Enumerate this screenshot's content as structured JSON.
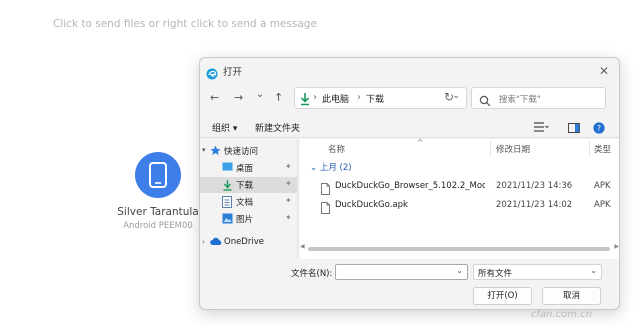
{
  "background_hint": "Click to send files or right click to send a message",
  "device": {
    "name": "Silver Tarantula",
    "model": "Android PEEM00",
    "accent": "#3d7ee8"
  },
  "dialog": {
    "title": "打开",
    "close": "✕",
    "nav": {
      "back": "←",
      "forward": "→",
      "dropdown": "⌄",
      "up": "↑",
      "refresh": "↻"
    },
    "address": {
      "icon": "download-arrow-icon",
      "sep1": "›",
      "part1": "此电脑",
      "sep2": "›",
      "part2": "下载",
      "dropdown": "⌄"
    },
    "search_placeholder": "搜索\"下载\"",
    "toolbar": {
      "organize": "组织 ▾",
      "new_folder": "新建文件夹"
    },
    "sidebar": {
      "quick_access": "快速访问",
      "desktop": "桌面",
      "downloads": "下载",
      "documents": "文档",
      "pictures": "图片",
      "onedrive": "OneDrive",
      "pin": "📌"
    },
    "columns": {
      "name": "名称",
      "modified": "修改日期",
      "type": "类型",
      "sort_icon": "^"
    },
    "group_label": "上月 (2)",
    "group_chevron": "⌄",
    "files": [
      {
        "name": "DuckDuckGo_Browser_5.102.2_Mod...",
        "date": "2021/11/23 14:36",
        "type": "APK"
      },
      {
        "name": "DuckDuckGo.apk",
        "date": "2021/11/23 14:02",
        "type": "APK"
      }
    ],
    "footer": {
      "filename_label": "文件名(N):",
      "filename_value": "",
      "filetype_value": "所有文件",
      "dropdown": "⌄",
      "open_button": "打开(O)",
      "cancel_button": "取消"
    }
  },
  "watermark": "cfan.com.cn"
}
